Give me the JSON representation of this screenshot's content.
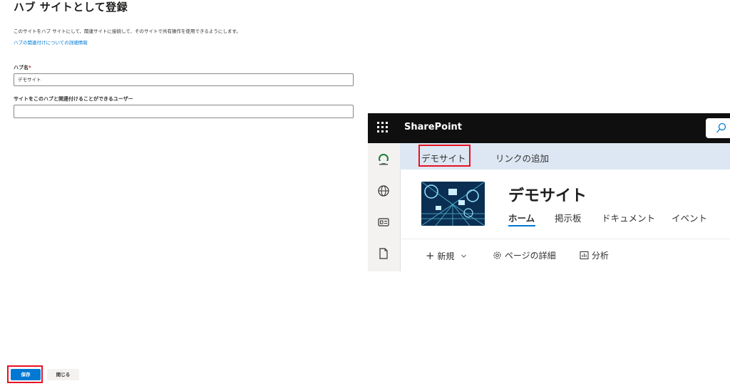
{
  "panel": {
    "title": "ハブ サイトとして登録",
    "description": "このサイトをハブ サイトにして、関連サイトに接続して、そのサイトで共有操作を使用できるようにします。",
    "learn_more": "ハブの関連付けについての詳細情報",
    "hub_name_label": "ハブ名",
    "required_mark": "*",
    "hub_name_value": "デモサイト",
    "users_label": "サイトをこのハブと関連付けることができるユーザー",
    "users_value": "",
    "save_label": "保存",
    "close_label": "閉じる"
  },
  "sharepoint": {
    "brand": "SharePoint",
    "hub_nav": [
      "デモサイト",
      "リンクの追加"
    ],
    "site_title": "デモサイト",
    "site_nav": [
      "ホーム",
      "掲示板",
      "ドキュメント",
      "イベント"
    ],
    "commands": {
      "new": "新規",
      "page_details": "ページの詳細",
      "analytics": "分析"
    },
    "rail_icons": [
      "site-logo-icon",
      "globe-icon",
      "news-icon",
      "document-icon"
    ]
  },
  "colors": {
    "accent": "#0078d4",
    "highlight": "#e81123",
    "hub_nav_bg": "#dde7f3",
    "suite_bar": "#0f0f0f"
  }
}
